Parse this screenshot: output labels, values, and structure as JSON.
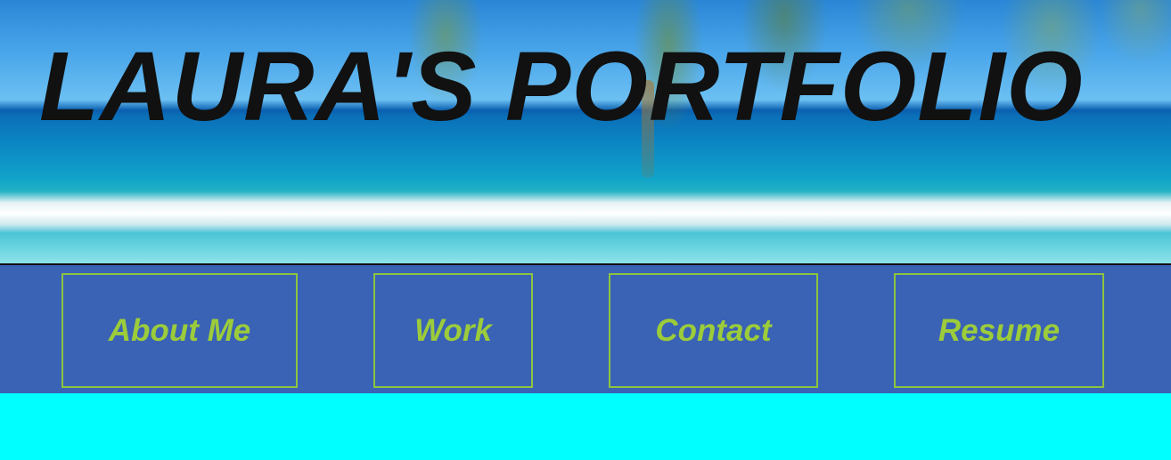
{
  "header": {
    "title": "LAURA'S PORTFOLIO",
    "background": "beach-with-palm-tree-photo"
  },
  "nav": {
    "items": [
      {
        "label": "About Me"
      },
      {
        "label": "Work"
      },
      {
        "label": "Contact"
      },
      {
        "label": "Resume"
      }
    ]
  },
  "colors": {
    "nav_background": "#3a62b5",
    "nav_text": "#9ccc3a",
    "nav_border": "#8dc43f",
    "page_background": "#00ffff",
    "title_text": "#111111"
  }
}
